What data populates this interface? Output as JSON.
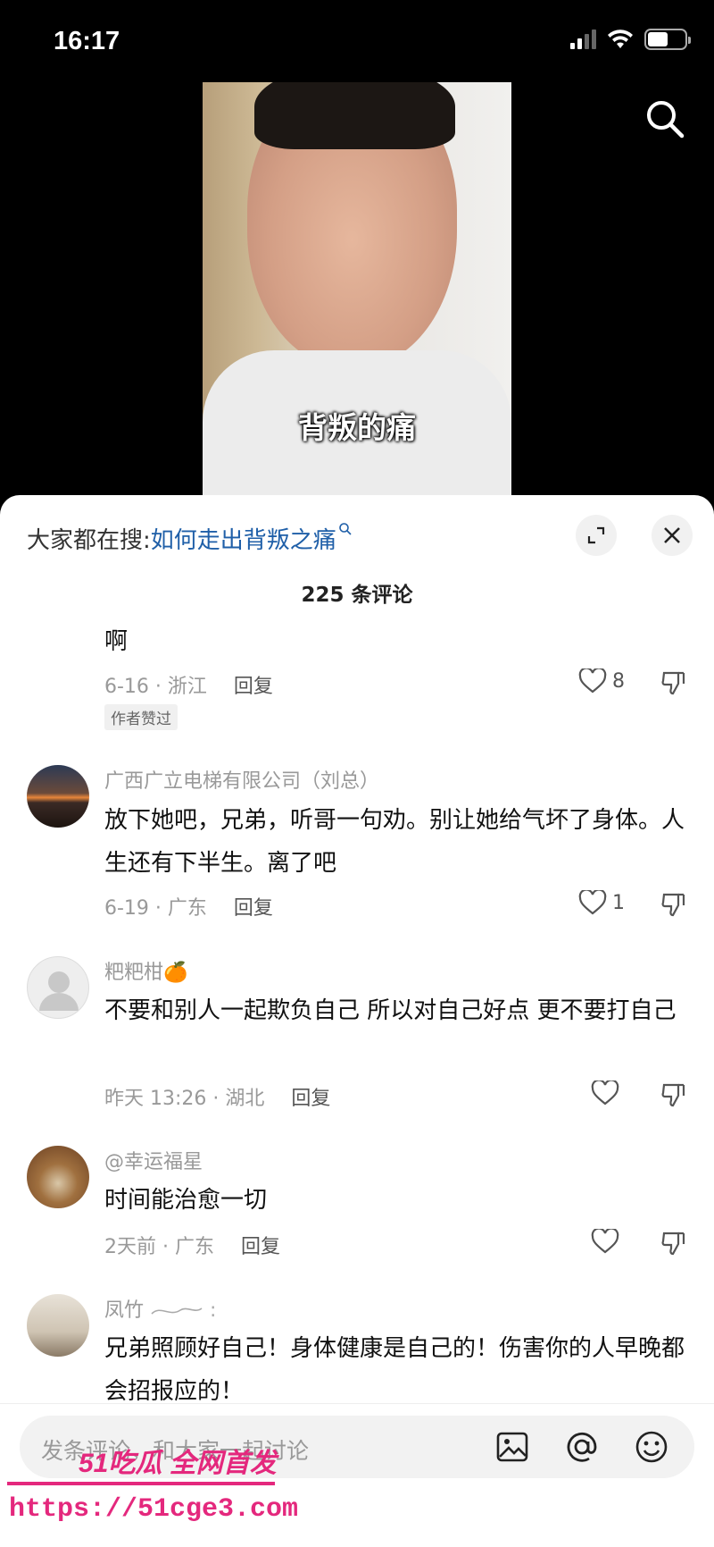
{
  "status": {
    "time": "16:17"
  },
  "video": {
    "caption": "背叛的痛"
  },
  "sheet": {
    "search_prefix": "大家都在搜:",
    "search_link": "如何走出背叛之痛",
    "comment_count": "225 条评论"
  },
  "comments": [
    {
      "name": "",
      "text": "啊",
      "meta": "6-16 · 浙江",
      "reply": "回复",
      "likes": "8",
      "badge": "作者赞过"
    },
    {
      "name": "广西广立电梯有限公司（刘总）",
      "text": "放下她吧，兄弟，听哥一句劝。别让她给气坏了身体。人生还有下半生。离了吧",
      "meta": "6-19 · 广东",
      "reply": "回复",
      "likes": "1"
    },
    {
      "name": "粑粑柑🍊",
      "text": "不要和别人一起欺负自己 所以对自己好点 更不要打自己",
      "meta": "昨天 13:26 · 湖北",
      "reply": "回复",
      "likes": ""
    },
    {
      "name": "@幸运福星",
      "text": "时间能治愈一切",
      "meta": "2天前 · 广东",
      "reply": "回复",
      "likes": ""
    },
    {
      "name": "凤竹 ",
      "text": "兄弟照顾好自己！身体健康是自己的！伤害你的人早晚都会招报应的！",
      "meta": "",
      "reply": "",
      "likes": ""
    }
  ],
  "input": {
    "placeholder": "发条评论，和大家一起讨论"
  },
  "watermark": {
    "brand": "51吃瓜 全网首发",
    "url": "https://51cge3.com"
  },
  "icons": [
    "search-icon",
    "expand-icon",
    "close-icon",
    "heart-icon",
    "dislike-icon",
    "image-icon",
    "at-icon",
    "emoji-icon"
  ]
}
